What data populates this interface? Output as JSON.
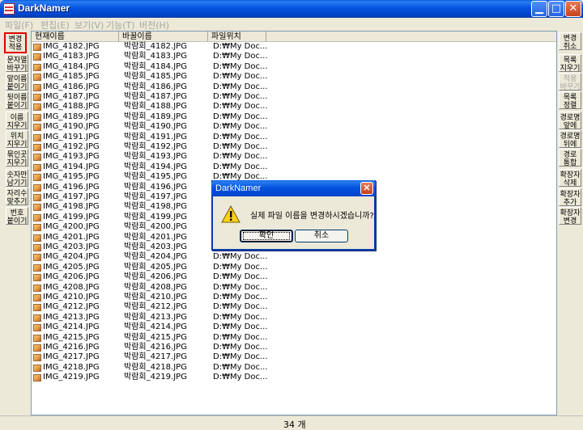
{
  "window": {
    "title": "DarkNamer"
  },
  "menu": [
    "파일(F)",
    "편집(E)",
    "보기(V)",
    "기능(T)",
    "버전(H)"
  ],
  "left_toolbar": [
    {
      "label": "변경 적용",
      "state": "selected"
    },
    {
      "label": "문자열 바꾸기",
      "state": "normal"
    },
    {
      "label": "앞이름 붙이기",
      "state": "normal"
    },
    {
      "label": "뒷이름 붙이기",
      "state": "normal"
    },
    {
      "label": "이름 지우기",
      "state": "normal"
    },
    {
      "label": "위치 지우기",
      "state": "normal"
    },
    {
      "label": "묶인곳 지우기",
      "state": "normal"
    },
    {
      "label": "숫자만 남기기",
      "state": "normal"
    },
    {
      "label": "자리수 맞추기",
      "state": "normal"
    },
    {
      "label": "번호 붙이기",
      "state": "normal"
    }
  ],
  "right_toolbar": [
    {
      "label": "변경 취소",
      "state": "normal"
    },
    {
      "label": "목록 지우기",
      "state": "normal"
    },
    {
      "label": "적용 바꾸기",
      "state": "disabled"
    },
    {
      "label": "목록 정렬",
      "state": "normal"
    },
    {
      "label": "경로명 앞에",
      "state": "normal"
    },
    {
      "label": "경로명 뒤에",
      "state": "normal"
    },
    {
      "label": "경로 통합",
      "state": "normal"
    },
    {
      "label": "확장자 삭제",
      "state": "normal"
    },
    {
      "label": "확장자 추가",
      "state": "normal"
    },
    {
      "label": "확장자 변경",
      "state": "normal"
    }
  ],
  "list": {
    "columns": [
      "현재이름",
      "바꿀이름",
      "파일위치"
    ],
    "rows": [
      {
        "current": "IMG_4182.JPG",
        "new": "박람회_4182.JPG",
        "path": "D:₩My Doc..."
      },
      {
        "current": "IMG_4183.JPG",
        "new": "박람회_4183.JPG",
        "path": "D:₩My Doc..."
      },
      {
        "current": "IMG_4184.JPG",
        "new": "박람회_4184.JPG",
        "path": "D:₩My Doc..."
      },
      {
        "current": "IMG_4185.JPG",
        "new": "박람회_4185.JPG",
        "path": "D:₩My Doc..."
      },
      {
        "current": "IMG_4186.JPG",
        "new": "박람회_4186.JPG",
        "path": "D:₩My Doc..."
      },
      {
        "current": "IMG_4187.JPG",
        "new": "박람회_4187.JPG",
        "path": "D:₩My Doc..."
      },
      {
        "current": "IMG_4188.JPG",
        "new": "박람회_4188.JPG",
        "path": "D:₩My Doc..."
      },
      {
        "current": "IMG_4189.JPG",
        "new": "박람회_4189.JPG",
        "path": "D:₩My Doc..."
      },
      {
        "current": "IMG_4190.JPG",
        "new": "박람회_4190.JPG",
        "path": "D:₩My Doc..."
      },
      {
        "current": "IMG_4191.JPG",
        "new": "박람회_4191.JPG",
        "path": "D:₩My Doc..."
      },
      {
        "current": "IMG_4192.JPG",
        "new": "박람회_4192.JPG",
        "path": "D:₩My Doc..."
      },
      {
        "current": "IMG_4193.JPG",
        "new": "박람회_4193.JPG",
        "path": "D:₩My Doc..."
      },
      {
        "current": "IMG_4194.JPG",
        "new": "박람회_4194.JPG",
        "path": "D:₩My Doc..."
      },
      {
        "current": "IMG_4195.JPG",
        "new": "박람회_4195.JPG",
        "path": "D:₩My Doc..."
      },
      {
        "current": "IMG_4196.JPG",
        "new": "박람회_4196.JPG",
        "path": ""
      },
      {
        "current": "IMG_4197.JPG",
        "new": "박람회_4197.JPG",
        "path": ""
      },
      {
        "current": "IMG_4198.JPG",
        "new": "박람회_4198.JPG",
        "path": ""
      },
      {
        "current": "IMG_4199.JPG",
        "new": "박람회_4199.JPG",
        "path": ""
      },
      {
        "current": "IMG_4200.JPG",
        "new": "박람회_4200.JPG",
        "path": ""
      },
      {
        "current": "IMG_4201.JPG",
        "new": "박람회_4201.JPG",
        "path": ""
      },
      {
        "current": "IMG_4203.JPG",
        "new": "박람회_4203.JPG",
        "path": ""
      },
      {
        "current": "IMG_4204.JPG",
        "new": "박람회_4204.JPG",
        "path": "D:₩My Doc..."
      },
      {
        "current": "IMG_4205.JPG",
        "new": "박람회_4205.JPG",
        "path": "D:₩My Doc..."
      },
      {
        "current": "IMG_4206.JPG",
        "new": "박람회_4206.JPG",
        "path": "D:₩My Doc..."
      },
      {
        "current": "IMG_4208.JPG",
        "new": "박람회_4208.JPG",
        "path": "D:₩My Doc..."
      },
      {
        "current": "IMG_4210.JPG",
        "new": "박람회_4210.JPG",
        "path": "D:₩My Doc..."
      },
      {
        "current": "IMG_4212.JPG",
        "new": "박람회_4212.JPG",
        "path": "D:₩My Doc..."
      },
      {
        "current": "IMG_4213.JPG",
        "new": "박람회_4213.JPG",
        "path": "D:₩My Doc..."
      },
      {
        "current": "IMG_4214.JPG",
        "new": "박람회_4214.JPG",
        "path": "D:₩My Doc..."
      },
      {
        "current": "IMG_4215.JPG",
        "new": "박람회_4215.JPG",
        "path": "D:₩My Doc..."
      },
      {
        "current": "IMG_4216.JPG",
        "new": "박람회_4216.JPG",
        "path": "D:₩My Doc..."
      },
      {
        "current": "IMG_4217.JPG",
        "new": "박람회_4217.JPG",
        "path": "D:₩My Doc..."
      },
      {
        "current": "IMG_4218.JPG",
        "new": "박람회_4218.JPG",
        "path": "D:₩My Doc..."
      },
      {
        "current": "IMG_4219.JPG",
        "new": "박람회_4219.JPG",
        "path": "D:₩My Doc..."
      }
    ]
  },
  "status": {
    "count": "34 개"
  },
  "dialog": {
    "title": "DarkNamer",
    "message": "실제 파일 이름을 변경하시겠습니까?",
    "ok_label": "확인",
    "cancel_label": "취소",
    "icon": "warning-icon"
  },
  "colors": {
    "titlebar": "#0553e0",
    "selected_border": "#e00000",
    "window_bg": "#ece9d8"
  }
}
